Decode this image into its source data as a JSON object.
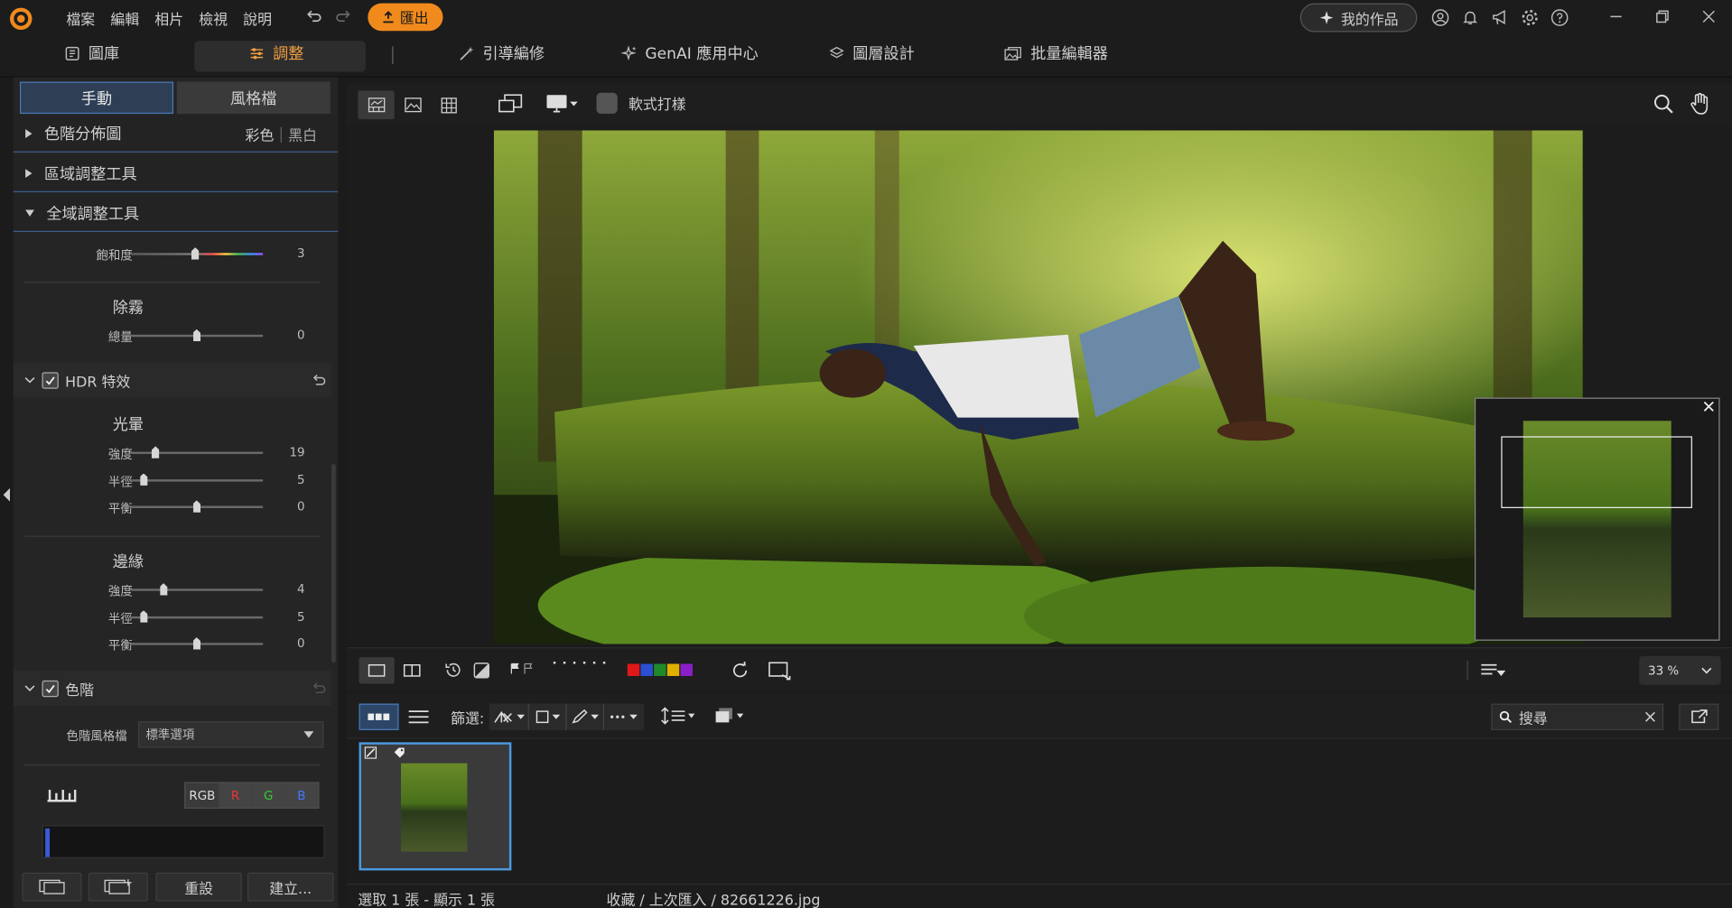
{
  "menu": [
    "檔案",
    "編輯",
    "相片",
    "檢視",
    "說明"
  ],
  "export_label": "匯出",
  "my_works_label": "我的作品",
  "nav_tabs": [
    {
      "label": "圖庫",
      "icon": "library-icon"
    },
    {
      "label": "調整",
      "icon": "sliders-icon",
      "active": true
    },
    {
      "label": "引導編修",
      "icon": "magic-wand-icon"
    },
    {
      "label": "GenAI 應用中心",
      "icon": "sparkle-icon"
    },
    {
      "label": "圖層設計",
      "icon": "layers-icon"
    },
    {
      "label": "批量編輯器",
      "icon": "batch-images-icon"
    }
  ],
  "left_tabs": {
    "manual": "手動",
    "style": "風格檔"
  },
  "sections": {
    "histogram": {
      "label": "色階分佈圖",
      "color": "彩色",
      "bw": "黑白"
    },
    "regional": {
      "label": "區域調整工具"
    },
    "global": {
      "label": "全域調整工具"
    }
  },
  "saturation": {
    "label": "飽和度",
    "value": "3",
    "pct": 0.49
  },
  "dehaze": {
    "title": "除霧",
    "label": "總量",
    "value": "0",
    "pct": 0.5
  },
  "hdr": {
    "title": "HDR 特效",
    "glow": {
      "title": "光暈",
      "rows": [
        {
          "label": "強度",
          "value": "19",
          "pct": 0.19
        },
        {
          "label": "半徑",
          "value": "5",
          "pct": 0.1
        },
        {
          "label": "平衡",
          "value": "0",
          "pct": 0.5
        }
      ]
    },
    "edge": {
      "title": "邊緣",
      "rows": [
        {
          "label": "強度",
          "value": "4",
          "pct": 0.25
        },
        {
          "label": "半徑",
          "value": "5",
          "pct": 0.1
        },
        {
          "label": "平衡",
          "value": "0",
          "pct": 0.5
        }
      ]
    }
  },
  "levels": {
    "title": "色階",
    "preset_label": "色階風格檔",
    "preset_value": "標準選項",
    "channels": [
      "RGB",
      "R",
      "G",
      "B"
    ]
  },
  "bottom_buttons": {
    "reset": "重設",
    "create": "建立..."
  },
  "view_toolbar": {
    "softproof": "軟式打樣"
  },
  "zoom": "33 %",
  "filter_label": "篩選:",
  "search_placeholder": "搜尋",
  "status": {
    "left": "選取 1 張 - 顯示 1 張",
    "path": "收藏 / 上次匯入 / 82661226.jpg"
  },
  "color_labels": [
    "#e01818",
    "#2a4fd0",
    "#1e8a2a",
    "#e0b000",
    "#8a1fc8"
  ]
}
